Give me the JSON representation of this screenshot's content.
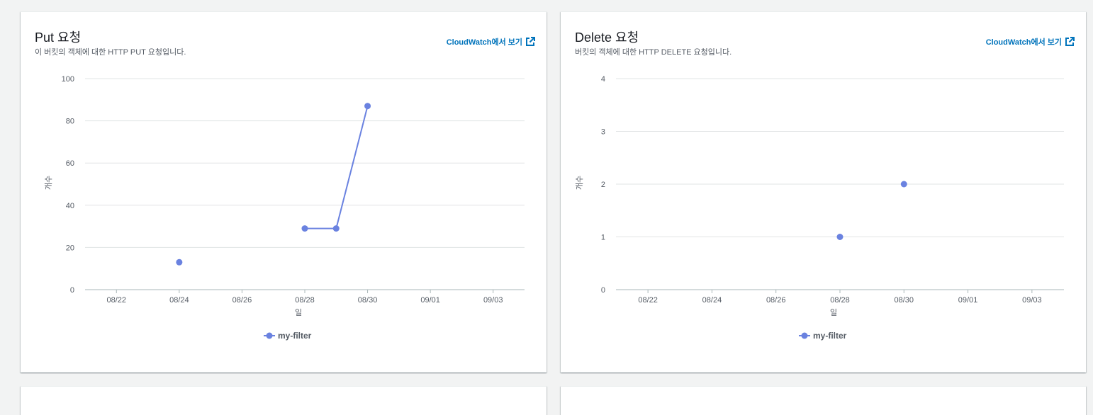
{
  "link_label": "CloudWatch에서 보기",
  "colors": {
    "series": "#6a82e0",
    "grid": "#e1e4e5",
    "axis": "#aab7b8",
    "text": "#545b64",
    "link": "#0073bb"
  },
  "cards": [
    {
      "title": "Put 요청",
      "description": "이 버킷의 객체에 대한 HTTP PUT 요청입니다."
    },
    {
      "title": "Delete 요청",
      "description": "버킷의 객체에 대한 HTTP DELETE 요청입니다."
    }
  ],
  "chart_data": [
    {
      "type": "line",
      "title": "Put 요청",
      "xlabel": "일",
      "ylabel": "개수",
      "ylim": [
        0,
        100
      ],
      "yticks": [
        0,
        20,
        40,
        60,
        80,
        100
      ],
      "xticks": [
        "08/22",
        "08/24",
        "08/26",
        "08/28",
        "08/30",
        "09/01",
        "09/03"
      ],
      "xlim": [
        "08/21",
        "09/04"
      ],
      "grid": true,
      "legend": "bottom-center",
      "series": [
        {
          "name": "my-filter",
          "points": [
            {
              "x": "08/24",
              "y": 13,
              "connected": false
            },
            {
              "x": "08/28",
              "y": 29,
              "connected": true
            },
            {
              "x": "08/29",
              "y": 29,
              "connected": true
            },
            {
              "x": "08/30",
              "y": 87,
              "connected": true
            }
          ]
        }
      ]
    },
    {
      "type": "scatter",
      "title": "Delete 요청",
      "xlabel": "일",
      "ylabel": "개수",
      "ylim": [
        0,
        4
      ],
      "yticks": [
        0,
        1,
        2,
        3,
        4
      ],
      "xticks": [
        "08/22",
        "08/24",
        "08/26",
        "08/28",
        "08/30",
        "09/01",
        "09/03"
      ],
      "xlim": [
        "08/21",
        "09/04"
      ],
      "grid": true,
      "legend": "bottom-center",
      "series": [
        {
          "name": "my-filter",
          "points": [
            {
              "x": "08/28",
              "y": 1,
              "connected": false
            },
            {
              "x": "08/30",
              "y": 2,
              "connected": false
            }
          ]
        }
      ]
    }
  ]
}
